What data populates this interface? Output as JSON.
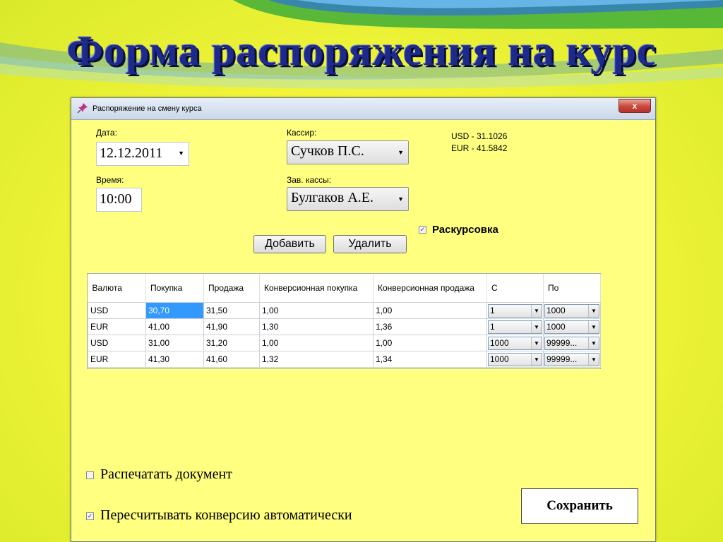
{
  "slide": {
    "title": "Форма распоряжения на курс"
  },
  "window": {
    "title": "Распоряжение на смену курса",
    "close_label": "x"
  },
  "form": {
    "date_label": "Дата:",
    "date_value": "12.12.2011",
    "time_label": "Время:",
    "time_value": "10:00",
    "cashier_label": "Кассир:",
    "cashier_value": "Сучков П.С.",
    "head_label": "Зав. кассы:",
    "head_value": "Булгаков А.Е.",
    "rates": {
      "usd": "USD - 31.1026",
      "eur": "EUR - 41.5842"
    },
    "rerate_label": "Раскурсовка",
    "rerate_checked": true,
    "add_button": "Добавить",
    "delete_button": "Удалить"
  },
  "grid": {
    "columns": [
      "Валюта",
      "Покупка",
      "Продажа",
      "Конверсионная покупка",
      "Конверсионная продажа",
      "С",
      "По"
    ],
    "rows": [
      {
        "currency": "USD",
        "buy": "30,70",
        "sell": "31,50",
        "conv_buy": "1,00",
        "conv_sell": "1,00",
        "from": "1",
        "to": "1000"
      },
      {
        "currency": "EUR",
        "buy": "41,00",
        "sell": "41,90",
        "conv_buy": "1,30",
        "conv_sell": "1,36",
        "from": "1",
        "to": "1000"
      },
      {
        "currency": "USD",
        "buy": "31,00",
        "sell": "31,20",
        "conv_buy": "1,00",
        "conv_sell": "1,00",
        "from": "1000",
        "to": "99999..."
      },
      {
        "currency": "EUR",
        "buy": "41,30",
        "sell": "41,60",
        "conv_buy": "1,32",
        "conv_sell": "1,34",
        "from": "1000",
        "to": "99999..."
      }
    ]
  },
  "options": {
    "print_label": "Распечатать документ",
    "print_checked": false,
    "recalc_label": "Пересчитывать конверсию автоматически",
    "recalc_checked": true
  },
  "save_button": "Сохранить",
  "colors": {
    "window_bg": "#ffff80",
    "title_text": "#1d2a8c",
    "selection": "#3399ff"
  }
}
